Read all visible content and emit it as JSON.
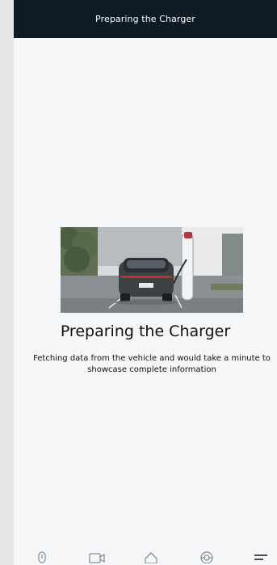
{
  "header": {
    "title": "Preparing the Charger"
  },
  "main": {
    "heading": "Preparing the Charger",
    "message": "Fetching data from the vehicle and would take a minute to showcase complete information",
    "hero_image": "ev-car-charging-photo"
  },
  "bottom_nav": {
    "items": [
      {
        "icon": "remote-key-icon"
      },
      {
        "icon": "video-camera-icon"
      },
      {
        "icon": "home-icon"
      },
      {
        "icon": "steering-wheel-icon"
      },
      {
        "icon": "menu-icon"
      }
    ]
  }
}
